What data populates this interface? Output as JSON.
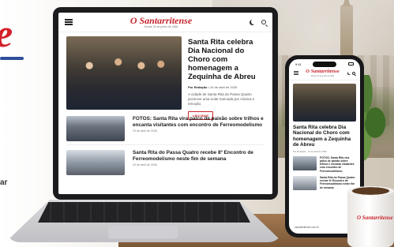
{
  "brand": {
    "edge_letter": "e",
    "side_word": "ar",
    "accent_color": "#c8232c",
    "swoosh_color": "#2e4f9a"
  },
  "laptop": {
    "header": {
      "logo": "O Santarritense",
      "tagline": "Desde 24 de junho de 1864",
      "menu_icon": "hamburger-icon",
      "theme_icon": "moon-icon",
      "search_icon": "search-icon"
    },
    "hero": {
      "title": "Santa Rita celebra Dia Nacional do Choro com homenagem a Zequinha de Abreu",
      "byline_author": "Por Redação",
      "byline_date": "24 de abril de 2026",
      "summary": "A cidade de Santa Rita do Passa Quatro promove uma noite marcada por música e emoção.",
      "read_more": "LEIA MAIS"
    },
    "stories": [
      {
        "title": "FOTOS: Santa Rita vira palco de paixão sobre trilhos e encanta visitantes com encontro de Ferreomodelismo",
        "date": "23 de abril de 2026"
      },
      {
        "title": "Santa Rita do Passa Quatro recebe 8º Encontro de Ferreomodelismo neste fim de semana",
        "date": "20 de abril de 2026"
      }
    ]
  },
  "phone": {
    "status_time": "9:41",
    "logo": "O Santarritense",
    "tagline": "Desde 24 de junho de 1864",
    "hero_title": "Santa Rita celebra Dia Nacional do Choro com homenagem a Zequinha de Abreu",
    "hero_byline": "Por Redação · 24 de abril de 2026",
    "stories": [
      {
        "title": "FOTOS: Santa Rita vira palco de paixão sobre trilhos e encanta visitantes com encontro de Ferreomodelismo"
      },
      {
        "title": "Santa Rita do Passa Quatro recebe 8º Encontro de Ferreomodelismo neste fim de semana"
      }
    ],
    "footer_url": "osantarritense.com.br"
  },
  "cup": {
    "logo": "O Santarritense"
  }
}
